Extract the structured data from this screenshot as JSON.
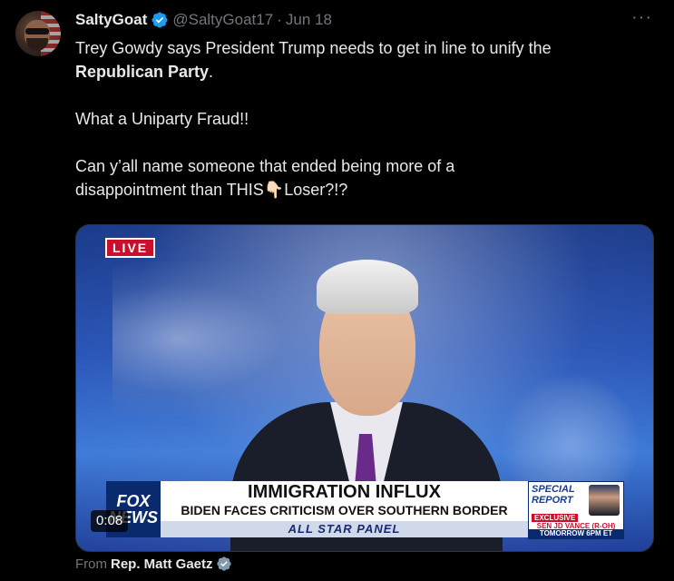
{
  "author": {
    "name": "SaltyGoat",
    "handle": "@SaltyGoat17",
    "separator": "·",
    "date": "Jun 18"
  },
  "more_menu_glyph": "···",
  "tweet_text": {
    "line1": "Trey Gowdy says President Trump needs to get in line to unify the",
    "line2_bold": "Republican Party",
    "line2_end": ".",
    "line3": "What a Uniparty Fraud!!",
    "line4": "Can y’all name someone that ended being more of a",
    "line5_start": "disappointment than THIS",
    "line5_emoji": "👇🏻",
    "line5_end": "Loser?!?"
  },
  "video": {
    "live_badge": "LIVE",
    "fox_logo_line1": "FOX",
    "fox_logo_line2": "NEWS",
    "chyron_title": "IMMIGRATION INFLUX",
    "chyron_subtitle": "BIDEN FACES CRITICISM OVER SOUTHERN BORDER CRISIS",
    "chyron_bar": "ALL STAR PANEL",
    "special_report_line1": "SPECIAL",
    "special_report_line2": "REPORT",
    "special_exclusive": "EXCLUSIVE",
    "special_name": "SEN JD VANCE (R-OH)",
    "special_time": "TOMORROW 6PM ET",
    "timestamp": "0:08"
  },
  "source": {
    "prefix": "From",
    "name": "Rep. Matt Gaetz"
  },
  "colors": {
    "background": "#000000",
    "text_primary": "#e7e9ea",
    "text_secondary": "#71767b",
    "verified_blue": "#1d9bf0",
    "verified_gray": "#829aab",
    "live_red": "#c8102e"
  },
  "icons": {
    "verified": "verified-badge-icon",
    "gov_verified": "gray-verified-badge-icon",
    "more": "more-icon"
  }
}
